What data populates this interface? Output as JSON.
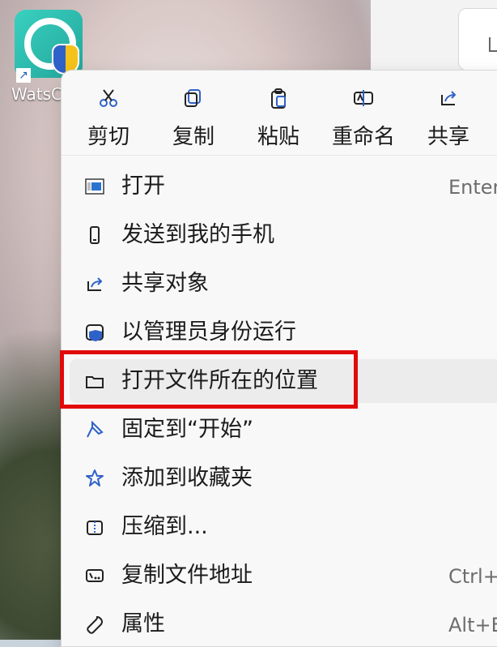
{
  "desktop": {
    "icon_label": "WatsC",
    "colors": {
      "accent": "#2f62c8",
      "highlight": "#e10a0a"
    }
  },
  "toolbar": {
    "items": [
      {
        "icon": "cut-icon",
        "label": "剪切"
      },
      {
        "icon": "copy-icon",
        "label": "复制"
      },
      {
        "icon": "paste-icon",
        "label": "粘贴"
      },
      {
        "icon": "rename-icon",
        "label": "重命名"
      },
      {
        "icon": "share-icon",
        "label": "共享"
      }
    ]
  },
  "menu": {
    "items": [
      {
        "icon": "open-icon",
        "label": "打开",
        "shortcut": "Enter"
      },
      {
        "icon": "phone-icon",
        "label": "发送到我的手机",
        "shortcut": ""
      },
      {
        "icon": "share-icon",
        "label": "共享对象",
        "shortcut": ""
      },
      {
        "icon": "admin-shield-icon",
        "label": "以管理员身份运行",
        "shortcut": ""
      },
      {
        "icon": "folder-icon",
        "label": "打开文件所在的位置",
        "shortcut": ""
      },
      {
        "icon": "pin-icon",
        "label": "固定到“开始”",
        "shortcut": ""
      },
      {
        "icon": "star-icon",
        "label": "添加到收藏夹",
        "shortcut": ""
      },
      {
        "icon": "zip-icon",
        "label": "压缩到...",
        "shortcut": ""
      },
      {
        "icon": "copy-path-icon",
        "label": "复制文件地址",
        "shortcut": "Ctrl+S"
      },
      {
        "icon": "wrench-icon",
        "label": "属性",
        "shortcut": "Alt+E"
      }
    ]
  }
}
